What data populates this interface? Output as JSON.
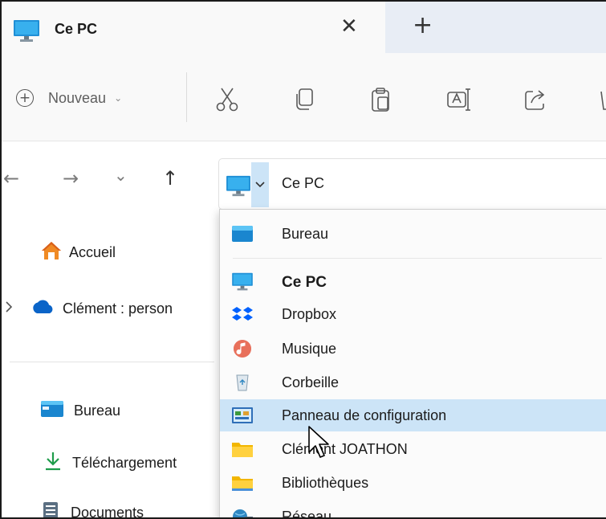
{
  "window": {
    "tab_title": "Ce PC",
    "tab_close_glyph": "✕",
    "new_tab_glyph": "+"
  },
  "toolbar": {
    "new_label": "Nouveau",
    "new_glyph": "+",
    "new_chevron": "⌄",
    "icons": [
      "cut-icon",
      "copy-icon",
      "paste-icon",
      "rename-icon",
      "share-icon",
      "delete-icon"
    ]
  },
  "nav": {
    "back_glyph": "←",
    "forward_glyph": "→",
    "recent_glyph": "⌄",
    "up_glyph": "↑"
  },
  "address": {
    "text": "Ce PC",
    "icon": "computer-icon"
  },
  "sidebar": {
    "items": [
      {
        "label": "Accueil",
        "icon": "home-icon"
      },
      {
        "label": "Clément : person",
        "icon": "onedrive-cloud-icon"
      },
      {
        "label": "Bureau",
        "icon": "desktop-folder-icon"
      },
      {
        "label": "Téléchargement",
        "icon": "download-icon"
      },
      {
        "label": "Documents",
        "icon": "documents-icon"
      }
    ]
  },
  "dropdown": {
    "items": [
      {
        "label": "Bureau",
        "icon": "desktop-folder-icon"
      },
      {
        "label": "Ce PC",
        "icon": "computer-icon"
      },
      {
        "label": "Dropbox",
        "icon": "dropbox-icon"
      },
      {
        "label": "Musique",
        "icon": "music-icon"
      },
      {
        "label": "Corbeille",
        "icon": "recycle-bin-icon"
      },
      {
        "label": "Panneau de configuration",
        "icon": "control-panel-icon"
      },
      {
        "label": "Clément JOATHON",
        "icon": "user-folder-icon"
      },
      {
        "label": "Bibliothèques",
        "icon": "libraries-icon"
      },
      {
        "label": "Réseau",
        "icon": "network-icon"
      }
    ],
    "selected": "Panneau de configuration"
  },
  "colors": {
    "highlight": "#cce4f7",
    "accent": "#0078d4",
    "tab_strip": "#e8edf5"
  }
}
